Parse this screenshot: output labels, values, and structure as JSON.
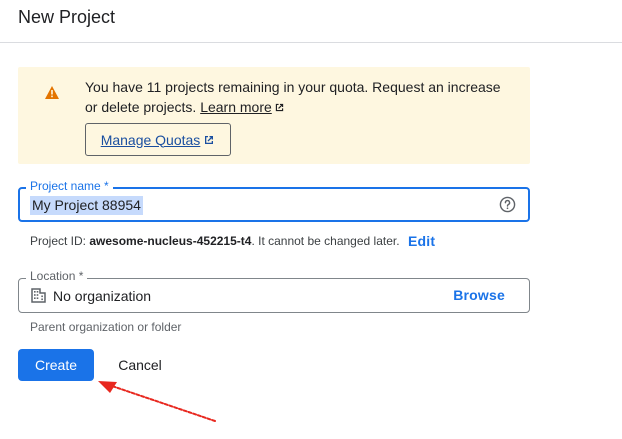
{
  "header": {
    "title": "New Project"
  },
  "quota_warning": {
    "icon": "warning-icon",
    "message": "You have 11 projects remaining in your quota. Request an increase or delete projects.",
    "learn_more": "Learn more",
    "manage_button": "Manage Quotas"
  },
  "project_name": {
    "label": "Project name *",
    "value": "My Project 88954",
    "help_icon": "help-circle-icon"
  },
  "project_id": {
    "prefix": "Project ID:",
    "value": "awesome-nucleus-452215-t4",
    "suffix": ". It cannot be changed later.",
    "edit_label": "Edit"
  },
  "location": {
    "label": "Location *",
    "value": "No organization",
    "browse_label": "Browse",
    "help_text": "Parent organization or folder",
    "icon": "building-icon"
  },
  "actions": {
    "create_label": "Create",
    "cancel_label": "Cancel"
  },
  "colors": {
    "primary": "#1a73e8",
    "warning_bg": "#fef7e0",
    "warning_icon": "#e37400",
    "annotation_arrow": "#e8281f"
  }
}
